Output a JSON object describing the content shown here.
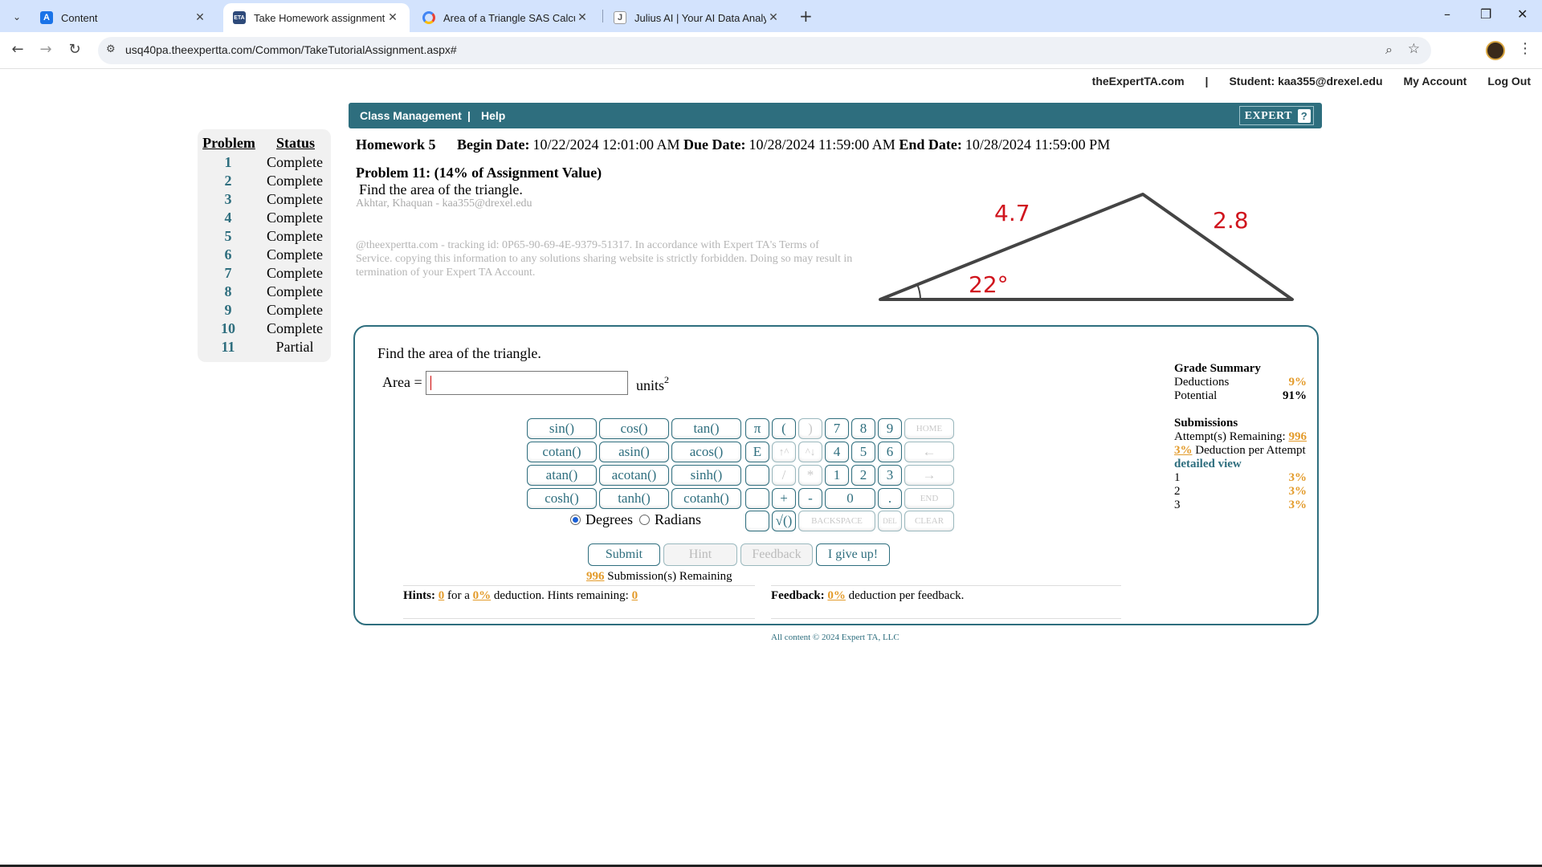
{
  "browser": {
    "tabs": [
      {
        "title": "Content",
        "icon": "A",
        "icon_color": "#1a73e8"
      },
      {
        "title": "Take Homework assignment",
        "icon": "ETA",
        "icon_color": "#2e4a7a"
      },
      {
        "title": "Area of a Triangle SAS Calculat",
        "icon": "G",
        "icon_color": "#ffffff"
      },
      {
        "title": "Julius AI | Your AI Data Analyst",
        "icon": "J",
        "icon_color": "#ffffff"
      }
    ],
    "url": "usq40pa.theexpertta.com/Common/TakeTutorialAssignment.aspx#"
  },
  "toplinks": {
    "site": "theExpertTA.com",
    "sep": "|",
    "student": "Student: kaa355@drexel.edu",
    "account": "My Account",
    "logout": "Log Out"
  },
  "nav": {
    "class_mgmt": "Class Management",
    "sep": "|",
    "help": "Help",
    "brand": "EXPERT",
    "brand_mark": "?"
  },
  "problem_list": {
    "header_problem": "Problem",
    "header_status": "Status",
    "items": [
      {
        "num": "1",
        "status": "Complete"
      },
      {
        "num": "2",
        "status": "Complete"
      },
      {
        "num": "3",
        "status": "Complete"
      },
      {
        "num": "4",
        "status": "Complete"
      },
      {
        "num": "5",
        "status": "Complete"
      },
      {
        "num": "6",
        "status": "Complete"
      },
      {
        "num": "7",
        "status": "Complete"
      },
      {
        "num": "8",
        "status": "Complete"
      },
      {
        "num": "9",
        "status": "Complete"
      },
      {
        "num": "10",
        "status": "Complete"
      },
      {
        "num": "11",
        "status": "Partial"
      }
    ]
  },
  "homework": {
    "name": "Homework 5",
    "begin_label": "Begin Date:",
    "begin": "10/22/2024 12:01:00 AM",
    "due_label": "Due Date:",
    "due": "10/28/2024 11:59:00 AM",
    "end_label": "End Date:",
    "end": "10/28/2024 11:59:00 PM"
  },
  "problem": {
    "title": "Problem 11: (14% of Assignment Value)",
    "question": "Find the area of the triangle.",
    "author": "Akhtar, Khaquan - kaa355@drexel.edu",
    "warning": "@theexpertta.com - tracking id: 0P65-90-69-4E-9379-51317. In accordance with Expert TA's Terms of Service. copying this information to any solutions sharing website is strictly forbidden. Doing so may result in termination of your Expert TA Account."
  },
  "figure": {
    "side_a": "4.7",
    "side_b": "2.8",
    "angle": "22°",
    "label_color": "#d0141d"
  },
  "answer": {
    "question": "Find the area of the triangle.",
    "label": "Area =",
    "value": "",
    "units": "units",
    "units_exp": "2"
  },
  "keypad": {
    "funcs": [
      "sin()",
      "cos()",
      "tan()",
      "cotan()",
      "asin()",
      "acos()",
      "atan()",
      "acotan()",
      "sinh()",
      "cosh()",
      "tanh()",
      "cotanh()"
    ],
    "pi": "π",
    "lparen": "(",
    "rparen": ")",
    "e": "E",
    "up": "↑^",
    "down": "^↓",
    "slash": "/",
    "star": "*",
    "plus": "+",
    "minus": "-",
    "sqrt": "√()",
    "n7": "7",
    "n8": "8",
    "n9": "9",
    "n4": "4",
    "n5": "5",
    "n6": "6",
    "n1": "1",
    "n2": "2",
    "n3": "3",
    "n0": "0",
    "dot": ".",
    "home": "HOME",
    "back_arrow": "←",
    "fwd_arrow": "→",
    "end": "END",
    "backspace": "BACKSPACE",
    "del": "DEL",
    "clear": "CLEAR",
    "degrees": "Degrees",
    "radians": "Radians"
  },
  "actions": {
    "submit": "Submit",
    "hint": "Hint",
    "feedback": "Feedback",
    "giveup": "I give up!"
  },
  "status": {
    "remaining_count": "996",
    "remaining_label": "Submission(s) Remaining",
    "hints_label": "Hints:",
    "hints_count": "0",
    "hints_for": "for a",
    "hints_pct": "0%",
    "hints_deduction": "deduction. Hints remaining:",
    "hints_remaining": "0",
    "feedback_label": "Feedback:",
    "feedback_pct": "0%",
    "feedback_text": "deduction per feedback."
  },
  "grade": {
    "title": "Grade Summary",
    "deductions_label": "Deductions",
    "deductions": "9%",
    "potential_label": "Potential",
    "potential": "91%",
    "submissions_title": "Submissions",
    "attempts_label": "Attempt(s) Remaining:",
    "attempts": "996",
    "per_attempt_pct": "3%",
    "per_attempt_label": "Deduction per Attempt",
    "detailed": "detailed view",
    "history": [
      {
        "n": "1",
        "pct": "3%"
      },
      {
        "n": "2",
        "pct": "3%"
      },
      {
        "n": "3",
        "pct": "3%"
      }
    ]
  },
  "footer": "All content © 2024 Expert TA, LLC"
}
